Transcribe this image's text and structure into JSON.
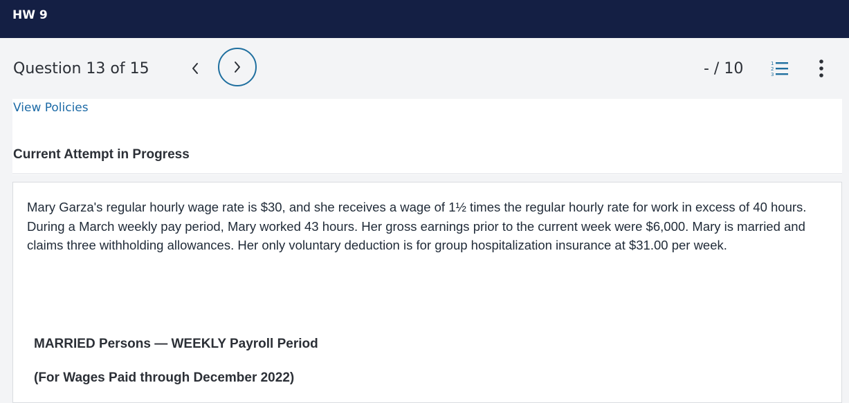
{
  "header": {
    "title": "HW 9"
  },
  "question_bar": {
    "label": "Question 13 of 15",
    "score": "- / 10",
    "prev_icon": "chevron-left-icon",
    "next_icon": "chevron-right-icon",
    "list_icon": "numbered-list-icon",
    "more_icon": "more-vertical-icon"
  },
  "links": {
    "view_policies": "View Policies"
  },
  "status": {
    "attempt": "Current Attempt in Progress"
  },
  "question": {
    "text": "Mary Garza's regular hourly wage rate is $30, and she receives a wage of 1½ times the regular hourly rate for work in excess of 40 hours. During a March weekly pay period, Mary worked 43 hours. Her gross earnings prior to the current week were $6,000. Mary is married and claims three withholding allowances. Her only voluntary deduction is for group hospitalization insurance at $31.00 per week.",
    "table_title": "MARRIED Persons — WEEKLY Payroll Period",
    "table_subtitle": "(For Wages Paid through December 2022)"
  },
  "colors": {
    "header_bg": "#141f44",
    "link": "#1c6aa6",
    "next_button_border": "#1f6f9f"
  }
}
